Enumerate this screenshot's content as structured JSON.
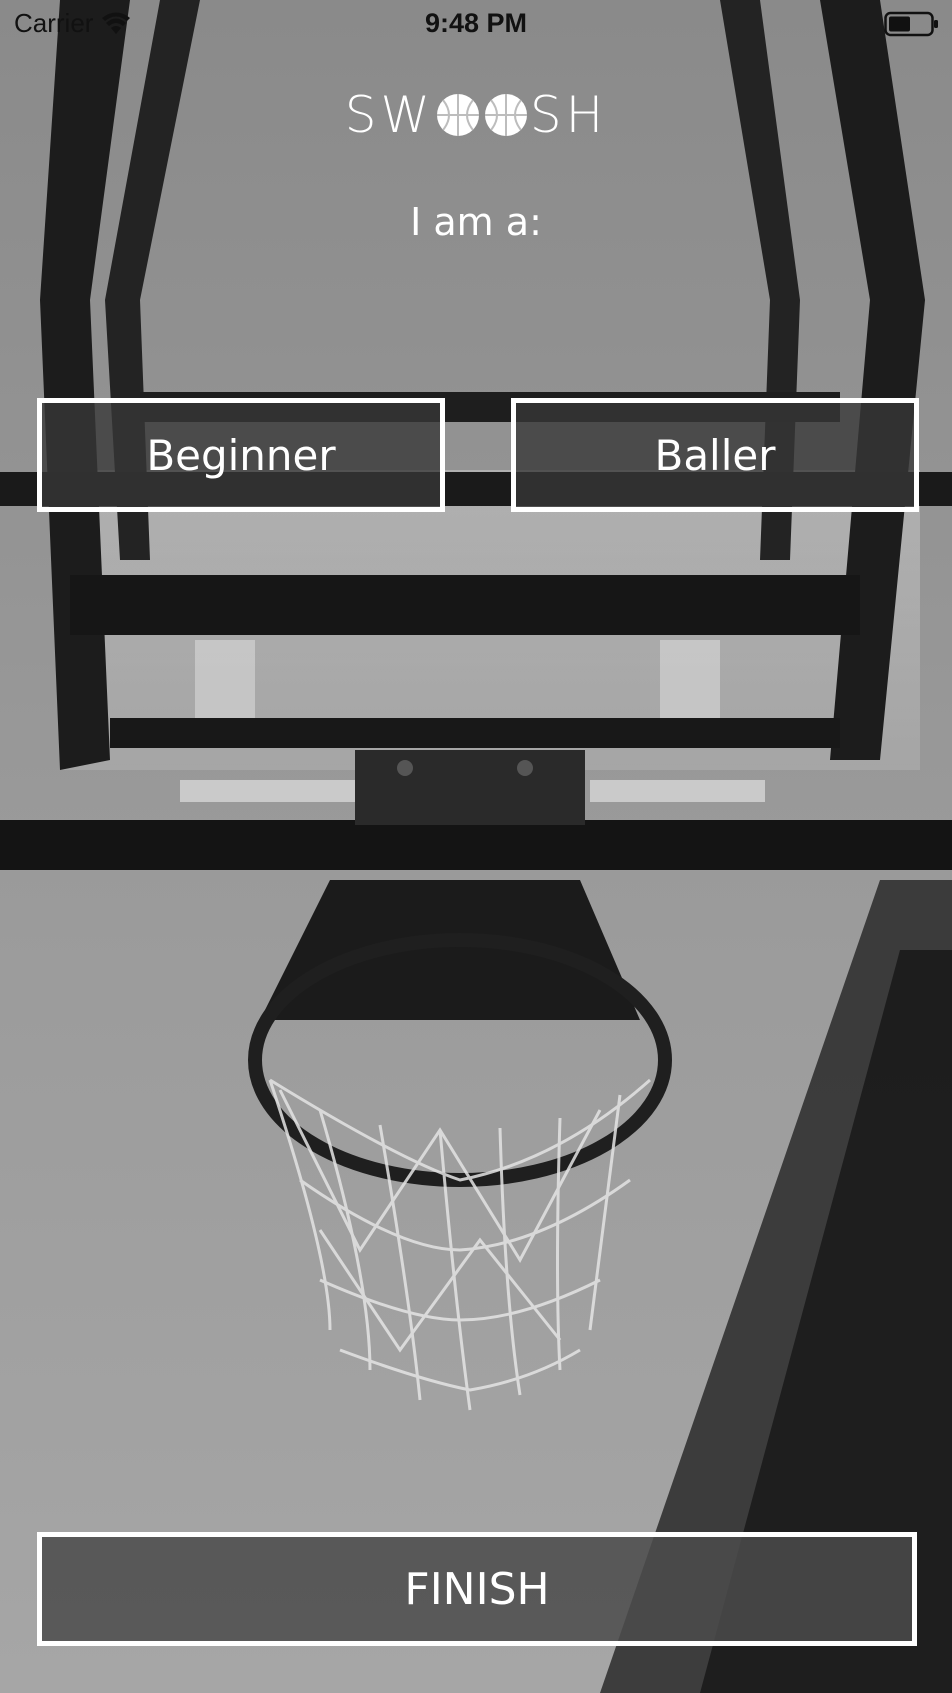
{
  "status_bar": {
    "carrier": "Carrier",
    "time": "9:48 PM"
  },
  "logo": {
    "part1": "SW",
    "part2": "SH"
  },
  "prompt": "I am a:",
  "buttons": {
    "beginner": "Beginner",
    "baller": "Baller",
    "finish": "FINISH"
  },
  "icons": {
    "wifi": "wifi-icon",
    "battery": "battery-icon",
    "logo_ball": "basketball-icon",
    "background": "basketball-hoop-photo"
  },
  "colors": {
    "text": "#ffffff",
    "button_fill": "#3a3a3a",
    "button_border": "#ffffff"
  }
}
